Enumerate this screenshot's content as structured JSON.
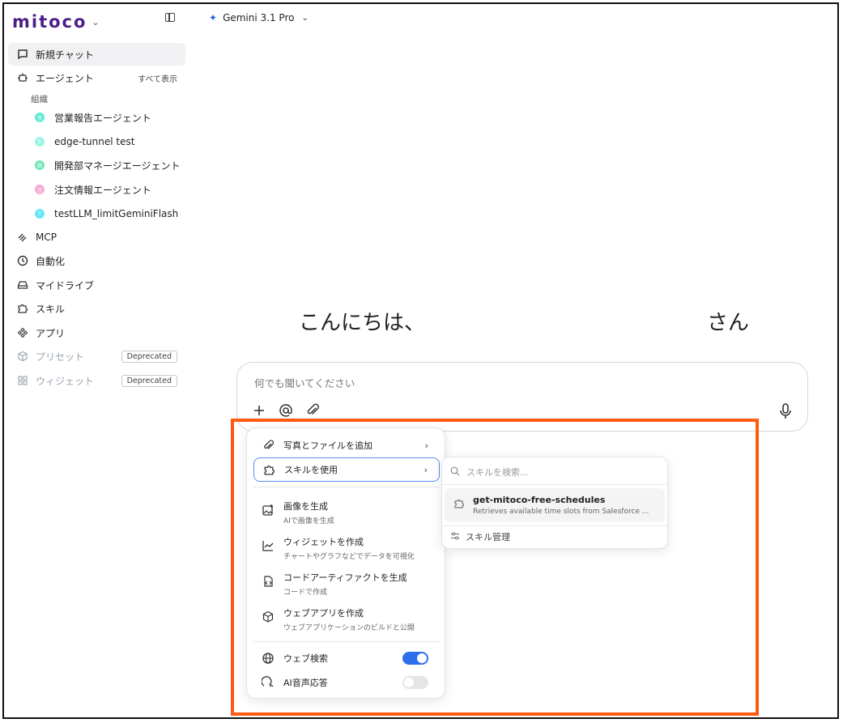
{
  "brand": {
    "logo_text": "mitoco"
  },
  "header": {
    "model_name": "Gemini 3.1 Pro"
  },
  "sidebar": {
    "new_chat": "新規チャット",
    "agents": {
      "label": "エージェント",
      "show_all": "すべて表示",
      "section": "組織",
      "items": [
        {
          "label": "営業報告エージェント",
          "initial": "営",
          "color": "#5eead4"
        },
        {
          "label": "edge-tunnel test",
          "initial": "E",
          "color": "#99f6e4"
        },
        {
          "label": "開発部マネージエージェント",
          "initial": "開",
          "color": "#6ee7b7"
        },
        {
          "label": "注文情報エージェント",
          "initial": "注",
          "color": "#f9a8d4"
        },
        {
          "label": "testLLM_limitGeminiFlash",
          "initial": "T",
          "color": "#67e8f9"
        }
      ]
    },
    "mcp": "MCP",
    "automation": "自動化",
    "my_drive": "マイドライブ",
    "skills": "スキル",
    "apps": "アプリ",
    "presets": {
      "label": "プリセット",
      "badge": "Deprecated"
    },
    "widgets": {
      "label": "ウィジェット",
      "badge": "Deprecated"
    }
  },
  "main": {
    "greeting": "こんにちは、",
    "greeting_suffix": "さん"
  },
  "composer": {
    "placeholder": "何でも聞いてください"
  },
  "menu": {
    "add_files": "写真とファイルを追加",
    "use_skill": "スキルを使用",
    "generate_image": {
      "title": "画像を生成",
      "desc": "AIで画像を生成"
    },
    "create_widget": {
      "title": "ウィジェットを作成",
      "desc": "チャートやグラフなどでデータを可視化"
    },
    "code_artifact": {
      "title": "コードアーティファクトを生成",
      "desc": "コードで作成"
    },
    "web_app": {
      "title": "ウェブアプリを作成",
      "desc": "ウェブアプリケーションのビルドと公開"
    },
    "web_search": {
      "label": "ウェブ検索",
      "enabled": true
    },
    "ai_voice": {
      "label": "AI音声応答",
      "enabled": false
    }
  },
  "submenu": {
    "search_placeholder": "スキルを検索...",
    "skills": [
      {
        "name": "get-mitoco-free-schedules",
        "desc": "Retrieves available time slots from Salesforce ..."
      }
    ],
    "manage": "スキル管理"
  },
  "colors": {
    "accent": "#2f6fed",
    "highlight": "#ff5a12",
    "brand": "#4b1e87"
  }
}
